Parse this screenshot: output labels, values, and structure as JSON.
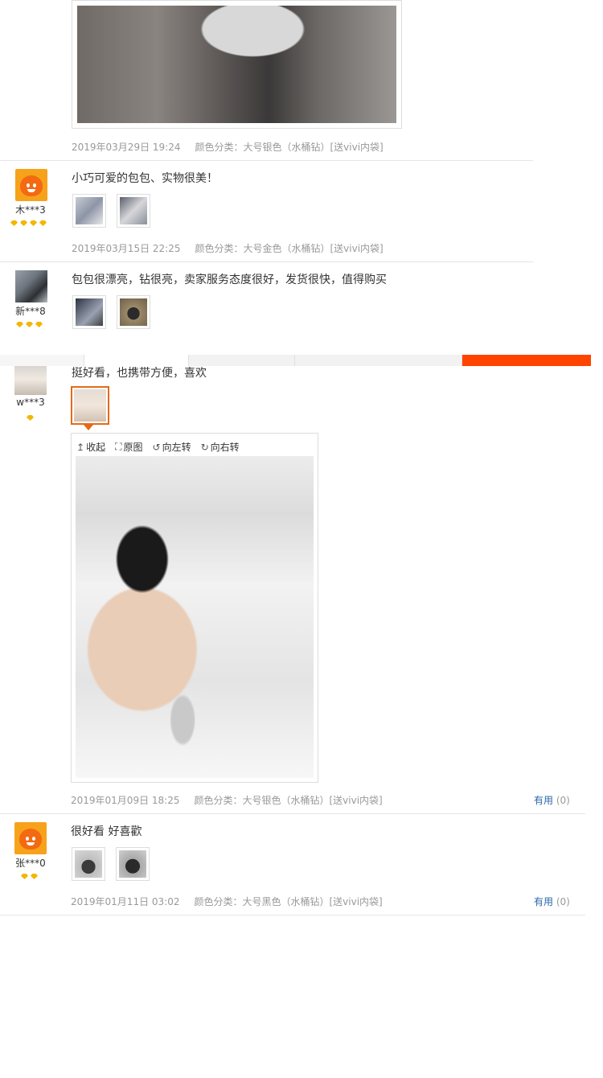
{
  "reviews": [
    {
      "date": "2019年03月29日 19:24",
      "sku": "颜色分类：大号银色（水桶钻）[送vivi内袋]"
    },
    {
      "user": "木***3",
      "gems": 4,
      "text": "小巧可爱的包包、实物很美！",
      "date": "2019年03月15日 22:25",
      "sku": "颜色分类：大号金色（水桶钻）[送vivi内袋]"
    },
    {
      "user": "新***8",
      "gems": 3,
      "text": "包包很漂亮，钻很亮，卖家服务态度很好，发货很快，值得购买"
    },
    {
      "user": "w***3",
      "gems": 1,
      "text": "挺好看，也携带方便，喜欢",
      "date": "2019年01月09日 18:25",
      "sku": "颜色分类：大号银色（水桶钻）[送vivi内袋]",
      "useful_label": "有用",
      "useful_count": "(0)"
    },
    {
      "user": "张***0",
      "gems": 2,
      "text": "很好看 好喜歡",
      "date": "2019年01月11日 03:02",
      "sku": "颜色分类：大号黑色（水桶钻）[送vivi内袋]",
      "useful_label": "有用",
      "useful_count": "(0)"
    }
  ],
  "viewer": {
    "collapse": "收起",
    "original": "原图",
    "rotate_left": "向左转",
    "rotate_right": "向右转"
  },
  "colors": {
    "accent": "#ff4400",
    "thumb_active": "#e66a16",
    "link": "#2a67a8",
    "gem": "#f2b705"
  }
}
